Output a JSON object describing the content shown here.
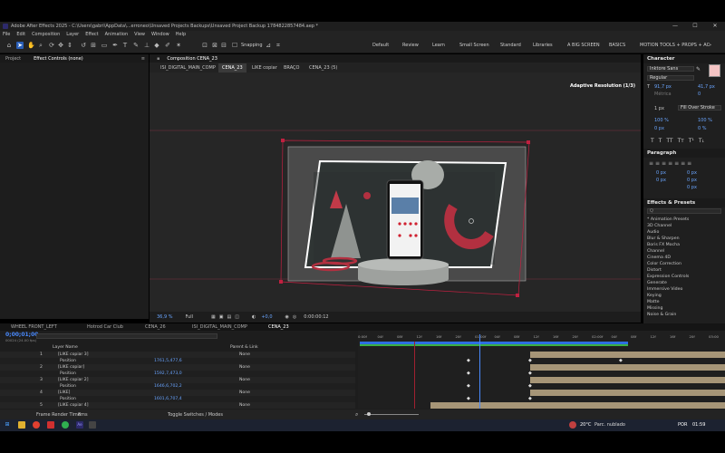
{
  "window": {
    "title": "Adobe After Effects 2025 - C:\\Users\\gabri\\AppData\\...erroneo\\Unsaved Projects Backups\\Unsaved Project Backup 1784822857484.aep *",
    "min": "—",
    "max": "☐",
    "close": "✕"
  },
  "menu": [
    "File",
    "Edit",
    "Composition",
    "Layer",
    "Effect",
    "Animation",
    "View",
    "Window",
    "Help"
  ],
  "toolbar": {
    "snapping": "Snapping",
    "workspaces": [
      "Default",
      "Review",
      "Learn",
      "Small Screen",
      "Standard",
      "Libraries",
      "A BIG SCREEN",
      "BASICS",
      "MOTION TOOLS + PROPS + AC"
    ],
    "overflow": "»"
  },
  "left_panel": {
    "tab_project": "Project",
    "tab_effect_controls": "Effect Controls (none)"
  },
  "composition": {
    "panel_tab": "Composition CENA_23",
    "breadcrumbs": [
      "ISI_DIGITAL_MAIN_COMP",
      "CENA_23",
      "LIKE copiar",
      "BRAÇO",
      "CENA_23 (5)"
    ],
    "adaptive": "Adaptive Resolution (1/3)",
    "footer": {
      "zoom": "36,9 %",
      "quality": "Full",
      "exposure": "+0,0",
      "time": "0:00:00:12"
    }
  },
  "character": {
    "title": "Character",
    "font": "Inktore Sans",
    "style": "Regular",
    "size": "91,7 px",
    "leading": "41,7 px",
    "tracking_label": "Métrica",
    "tracking": "0",
    "stroke_width": "1 px",
    "stroke_type": "Fill Over Stroke",
    "vert_scale": "100 %",
    "horiz_scale": "100 %",
    "baseline": "0 px",
    "tsume": "0 %",
    "style_buttons": [
      "T",
      "T",
      "TT",
      "Tт",
      "T¹",
      "T₁"
    ]
  },
  "paragraph": {
    "title": "Paragraph",
    "indent_values": [
      "0 px",
      "0 px",
      "0 px",
      "0 px",
      "0 px"
    ]
  },
  "effects": {
    "title": "Effects & Presets",
    "search_placeholder": "Q",
    "items": [
      "* Animation Presets",
      "3D Channel",
      "Audio",
      "Blur & Sharpen",
      "Boris FX Mocha",
      "Channel",
      "Cinema 4D",
      "Color Correction",
      "Distort",
      "Expression Controls",
      "Generate",
      "Immersive Video",
      "Keying",
      "Matte",
      "Missing",
      "Noise & Grain"
    ]
  },
  "timeline": {
    "tabs": [
      "WHEEL FRONT_LEFT",
      "Hotrod Car Club",
      "CENA_26",
      "ISI_DIGITAL_MAIN_COMP",
      "CENA_23"
    ],
    "current_time": "0;00;01;00",
    "time_sub": "00024 (24.00 fps)",
    "col_layer_name": "Layer Name",
    "col_parent": "Parent & Link",
    "ruler": [
      "0:00f",
      "04f",
      "08f",
      "12f",
      "16f",
      "20f",
      "01:00f",
      "04f",
      "08f",
      "12f",
      "16f",
      "20f",
      "02:00f",
      "04f",
      "08f",
      "12f",
      "16f",
      "20f",
      "03:00"
    ],
    "rows": [
      {
        "num": "1",
        "name": "[LIKE copiar 3]",
        "value": "",
        "parent": "None"
      },
      {
        "num": "",
        "name": "Position",
        "value": "1761,5,477,6",
        "parent": ""
      },
      {
        "num": "2",
        "name": "[LIKE copiar]",
        "value": "",
        "parent": "None"
      },
      {
        "num": "",
        "name": "Position",
        "value": "1592,7,473,0",
        "parent": ""
      },
      {
        "num": "3",
        "name": "[LIKE copiar 2]",
        "value": "",
        "parent": "None"
      },
      {
        "num": "",
        "name": "Position",
        "value": "1646,6,702,2",
        "parent": ""
      },
      {
        "num": "4",
        "name": "[LIKE]",
        "value": "",
        "parent": "None"
      },
      {
        "num": "",
        "name": "Position",
        "value": "1601,6,707,4",
        "parent": ""
      },
      {
        "num": "5",
        "name": "[LIKE copiar 4]",
        "value": "",
        "parent": "None"
      }
    ],
    "frame_render": "Frame Render Time:",
    "frame_render_value": "8ms",
    "toggle": "Toggle Switches / Modes"
  },
  "taskbar": {
    "weather_temp": "20°C",
    "weather_text": "Parc. nublado",
    "lang": "POR",
    "time": "01:59"
  },
  "colors": {
    "accent": "#2a5fb8",
    "time_blue": "#4a8bff",
    "selection_red": "#c02040",
    "workarea": "#c8b38d"
  }
}
